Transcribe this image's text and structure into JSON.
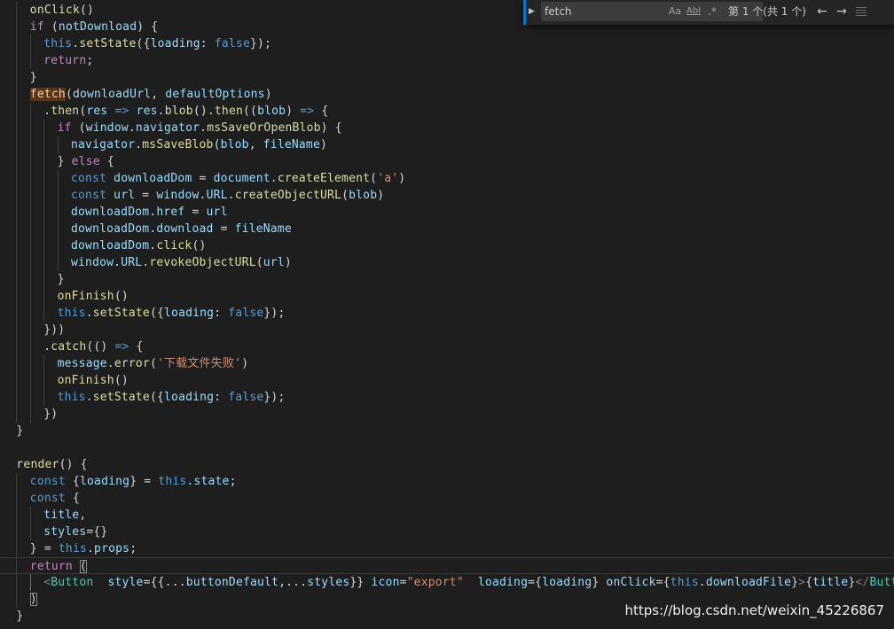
{
  "find": {
    "query": "fetch",
    "match_case_label": "Aa",
    "whole_word_label": "Abl",
    "regex_label": ".*",
    "match_count": "第 1 个(共 1 个)"
  },
  "watermark": "https://blog.csdn.net/weixin_45226867",
  "code_lines": [
    {
      "indent": 2,
      "guides": [
        1
      ],
      "tokens": [
        [
          "f",
          "onClick"
        ],
        [
          "p",
          "()"
        ]
      ]
    },
    {
      "indent": 2,
      "guides": [
        1
      ],
      "tokens": [
        [
          "c",
          "if"
        ],
        [
          "p",
          " ("
        ],
        [
          "v",
          "notDownload"
        ],
        [
          "p",
          ") {"
        ]
      ]
    },
    {
      "indent": 3,
      "guides": [
        1,
        2
      ],
      "tokens": [
        [
          "k",
          "this"
        ],
        [
          "p",
          "."
        ],
        [
          "f",
          "setState"
        ],
        [
          "p",
          "({"
        ],
        [
          "v",
          "loading"
        ],
        [
          "p",
          ": "
        ],
        [
          "k",
          "false"
        ],
        [
          "p",
          "});"
        ]
      ]
    },
    {
      "indent": 3,
      "guides": [
        1,
        2
      ],
      "tokens": [
        [
          "c",
          "return"
        ],
        [
          "p",
          ";"
        ]
      ]
    },
    {
      "indent": 2,
      "guides": [
        1
      ],
      "tokens": [
        [
          "p",
          "}"
        ]
      ]
    },
    {
      "indent": 2,
      "guides": [
        1
      ],
      "tokens": [
        [
          "f",
          "fetch",
          "hl"
        ],
        [
          "p",
          "("
        ],
        [
          "v",
          "downloadUrl"
        ],
        [
          "p",
          ", "
        ],
        [
          "v",
          "defaultOptions"
        ],
        [
          "p",
          ")"
        ]
      ]
    },
    {
      "indent": 3,
      "guides": [
        1,
        2
      ],
      "tokens": [
        [
          "p",
          "."
        ],
        [
          "f",
          "then"
        ],
        [
          "p",
          "("
        ],
        [
          "v",
          "res"
        ],
        [
          "p",
          " "
        ],
        [
          "k",
          "=>"
        ],
        [
          "p",
          " "
        ],
        [
          "v",
          "res"
        ],
        [
          "p",
          "."
        ],
        [
          "f",
          "blob"
        ],
        [
          "p",
          "()."
        ],
        [
          "f",
          "then"
        ],
        [
          "p",
          "(("
        ],
        [
          "v",
          "blob"
        ],
        [
          "p",
          ") "
        ],
        [
          "k",
          "=>"
        ],
        [
          "p",
          " {"
        ]
      ]
    },
    {
      "indent": 4,
      "guides": [
        1,
        2,
        3
      ],
      "tokens": [
        [
          "c",
          "if"
        ],
        [
          "p",
          " ("
        ],
        [
          "v",
          "window"
        ],
        [
          "p",
          "."
        ],
        [
          "v",
          "navigator"
        ],
        [
          "p",
          "."
        ],
        [
          "f",
          "msSaveOrOpenBlob"
        ],
        [
          "p",
          ") {"
        ]
      ]
    },
    {
      "indent": 5,
      "guides": [
        1,
        2,
        3,
        4
      ],
      "tokens": [
        [
          "v",
          "navigator"
        ],
        [
          "p",
          "."
        ],
        [
          "f",
          "msSaveBlob"
        ],
        [
          "p",
          "("
        ],
        [
          "v",
          "blob"
        ],
        [
          "p",
          ", "
        ],
        [
          "v",
          "fileName"
        ],
        [
          "p",
          ")"
        ]
      ]
    },
    {
      "indent": 4,
      "guides": [
        1,
        2,
        3
      ],
      "tokens": [
        [
          "p",
          "} "
        ],
        [
          "c",
          "else"
        ],
        [
          "p",
          " {"
        ]
      ]
    },
    {
      "indent": 5,
      "guides": [
        1,
        2,
        3,
        4
      ],
      "tokens": [
        [
          "k",
          "const"
        ],
        [
          "p",
          " "
        ],
        [
          "v",
          "downloadDom"
        ],
        [
          "p",
          " = "
        ],
        [
          "v",
          "document"
        ],
        [
          "p",
          "."
        ],
        [
          "f",
          "createElement"
        ],
        [
          "p",
          "("
        ],
        [
          "s",
          "'a'"
        ],
        [
          "p",
          ")"
        ]
      ]
    },
    {
      "indent": 5,
      "guides": [
        1,
        2,
        3,
        4
      ],
      "tokens": [
        [
          "k",
          "const"
        ],
        [
          "p",
          " "
        ],
        [
          "v",
          "url"
        ],
        [
          "p",
          " = "
        ],
        [
          "v",
          "window"
        ],
        [
          "p",
          "."
        ],
        [
          "v",
          "URL"
        ],
        [
          "p",
          "."
        ],
        [
          "f",
          "createObjectURL"
        ],
        [
          "p",
          "("
        ],
        [
          "v",
          "blob"
        ],
        [
          "p",
          ")"
        ]
      ]
    },
    {
      "indent": 5,
      "guides": [
        1,
        2,
        3,
        4
      ],
      "tokens": [
        [
          "v",
          "downloadDom"
        ],
        [
          "p",
          "."
        ],
        [
          "v",
          "href"
        ],
        [
          "p",
          " = "
        ],
        [
          "v",
          "url"
        ]
      ]
    },
    {
      "indent": 5,
      "guides": [
        1,
        2,
        3,
        4
      ],
      "tokens": [
        [
          "v",
          "downloadDom"
        ],
        [
          "p",
          "."
        ],
        [
          "v",
          "download"
        ],
        [
          "p",
          " = "
        ],
        [
          "v",
          "fileName"
        ]
      ]
    },
    {
      "indent": 5,
      "guides": [
        1,
        2,
        3,
        4
      ],
      "tokens": [
        [
          "v",
          "downloadDom"
        ],
        [
          "p",
          "."
        ],
        [
          "f",
          "click"
        ],
        [
          "p",
          "()"
        ]
      ]
    },
    {
      "indent": 5,
      "guides": [
        1,
        2,
        3,
        4
      ],
      "tokens": [
        [
          "v",
          "window"
        ],
        [
          "p",
          "."
        ],
        [
          "v",
          "URL"
        ],
        [
          "p",
          "."
        ],
        [
          "f",
          "revokeObjectURL"
        ],
        [
          "p",
          "("
        ],
        [
          "v",
          "url"
        ],
        [
          "p",
          ")"
        ]
      ]
    },
    {
      "indent": 4,
      "guides": [
        1,
        2,
        3
      ],
      "tokens": [
        [
          "p",
          "}"
        ]
      ]
    },
    {
      "indent": 4,
      "guides": [
        1,
        2,
        3
      ],
      "tokens": [
        [
          "f",
          "onFinish"
        ],
        [
          "p",
          "()"
        ]
      ]
    },
    {
      "indent": 4,
      "guides": [
        1,
        2,
        3
      ],
      "tokens": [
        [
          "k",
          "this"
        ],
        [
          "p",
          "."
        ],
        [
          "f",
          "setState"
        ],
        [
          "p",
          "({"
        ],
        [
          "v",
          "loading"
        ],
        [
          "p",
          ": "
        ],
        [
          "k",
          "false"
        ],
        [
          "p",
          "});"
        ]
      ]
    },
    {
      "indent": 3,
      "guides": [
        1,
        2
      ],
      "tokens": [
        [
          "p",
          "}))"
        ]
      ]
    },
    {
      "indent": 3,
      "guides": [
        1,
        2
      ],
      "tokens": [
        [
          "p",
          "."
        ],
        [
          "f",
          "catch"
        ],
        [
          "p",
          "(() "
        ],
        [
          "k",
          "=>"
        ],
        [
          "p",
          " {"
        ]
      ]
    },
    {
      "indent": 4,
      "guides": [
        1,
        2,
        3
      ],
      "tokens": [
        [
          "v",
          "message"
        ],
        [
          "p",
          "."
        ],
        [
          "f",
          "error"
        ],
        [
          "p",
          "("
        ],
        [
          "s",
          "'下载文件失败'"
        ],
        [
          "p",
          ")"
        ]
      ]
    },
    {
      "indent": 4,
      "guides": [
        1,
        2,
        3
      ],
      "tokens": [
        [
          "f",
          "onFinish"
        ],
        [
          "p",
          "()"
        ]
      ]
    },
    {
      "indent": 4,
      "guides": [
        1,
        2,
        3
      ],
      "tokens": [
        [
          "k",
          "this"
        ],
        [
          "p",
          "."
        ],
        [
          "f",
          "setState"
        ],
        [
          "p",
          "({"
        ],
        [
          "v",
          "loading"
        ],
        [
          "p",
          ": "
        ],
        [
          "k",
          "false"
        ],
        [
          "p",
          "});"
        ]
      ]
    },
    {
      "indent": 3,
      "guides": [
        1,
        2
      ],
      "tokens": [
        [
          "p",
          "})"
        ]
      ]
    },
    {
      "indent": 1,
      "guides": [],
      "tokens": [
        [
          "p",
          "}"
        ]
      ]
    },
    {
      "indent": 0,
      "guides": [],
      "tokens": []
    },
    {
      "indent": 1,
      "guides": [],
      "tokens": [
        [
          "f",
          "render"
        ],
        [
          "p",
          "() {"
        ]
      ]
    },
    {
      "indent": 2,
      "guides": [
        1
      ],
      "tokens": [
        [
          "k",
          "const"
        ],
        [
          "p",
          " {"
        ],
        [
          "v",
          "loading"
        ],
        [
          "p",
          "} = "
        ],
        [
          "k",
          "this"
        ],
        [
          "p",
          "."
        ],
        [
          "v",
          "state"
        ],
        [
          "p",
          ";"
        ]
      ]
    },
    {
      "indent": 2,
      "guides": [
        1
      ],
      "tokens": [
        [
          "k",
          "const"
        ],
        [
          "p",
          " {"
        ]
      ]
    },
    {
      "indent": 3,
      "guides": [
        1,
        2
      ],
      "tokens": [
        [
          "v",
          "title"
        ],
        [
          "p",
          ","
        ]
      ]
    },
    {
      "indent": 3,
      "guides": [
        1,
        2
      ],
      "tokens": [
        [
          "v",
          "styles"
        ],
        [
          "p",
          "={}"
        ]
      ]
    },
    {
      "indent": 2,
      "guides": [
        1
      ],
      "tokens": [
        [
          "p",
          "} = "
        ],
        [
          "k",
          "this"
        ],
        [
          "p",
          "."
        ],
        [
          "v",
          "props"
        ],
        [
          "p",
          ";"
        ]
      ]
    },
    {
      "indent": 2,
      "guides": [
        1
      ],
      "current": true,
      "tokens": [
        [
          "c",
          "return"
        ],
        [
          "p",
          " "
        ],
        [
          "p",
          "(",
          "bm"
        ]
      ]
    },
    {
      "indent": 3,
      "guides": [
        1,
        2
      ],
      "active": 2,
      "tokens": [
        [
          "tg",
          "<"
        ],
        [
          "j",
          "Button"
        ],
        [
          "p",
          "  "
        ],
        [
          "v",
          "style"
        ],
        [
          "p",
          "={{..."
        ],
        [
          "v",
          "buttonDefault"
        ],
        [
          "p",
          ",..."
        ],
        [
          "v",
          "styles"
        ],
        [
          "p",
          "}} "
        ],
        [
          "v",
          "icon"
        ],
        [
          "p",
          "="
        ],
        [
          "s",
          "\"export\""
        ],
        [
          "p",
          "  "
        ],
        [
          "v",
          "loading"
        ],
        [
          "p",
          "={"
        ],
        [
          "v",
          "loading"
        ],
        [
          "p",
          "} "
        ],
        [
          "v",
          "onClick"
        ],
        [
          "p",
          "={"
        ],
        [
          "k",
          "this"
        ],
        [
          "p",
          "."
        ],
        [
          "v",
          "downloadFile"
        ],
        [
          "p",
          "}"
        ],
        [
          "tg",
          ">"
        ],
        [
          "p",
          "{"
        ],
        [
          "v",
          "title"
        ],
        [
          "p",
          "}"
        ],
        [
          "tg",
          "</"
        ],
        [
          "j",
          "Button"
        ],
        [
          "tg",
          ">"
        ]
      ]
    },
    {
      "indent": 2,
      "guides": [
        1
      ],
      "active": 2,
      "tokens": [
        [
          "p",
          ")",
          "bm"
        ]
      ]
    },
    {
      "indent": 1,
      "guides": [],
      "tokens": [
        [
          "p",
          "}"
        ]
      ]
    }
  ]
}
